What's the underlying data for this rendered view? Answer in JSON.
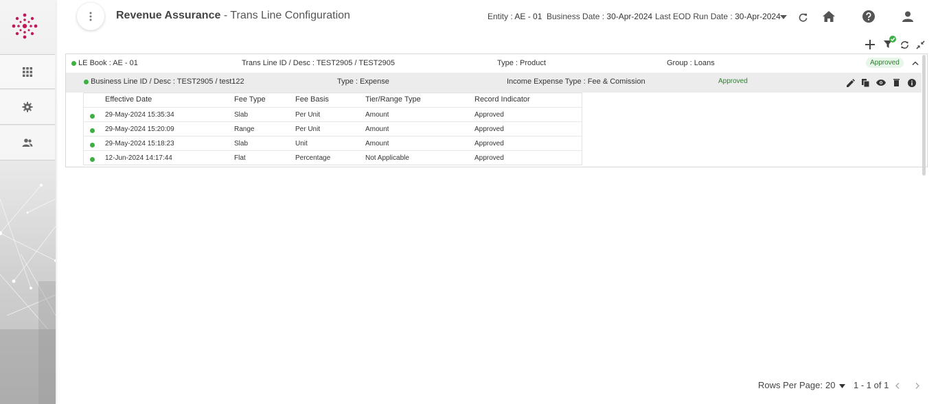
{
  "header": {
    "title_main": "Revenue Assurance",
    "title_sub": " - Trans Line Configuration",
    "entity_label": "Entity :",
    "entity_value": "AE - 01",
    "business_date_label": "Business Date :",
    "business_date_value": "30-Apr-2024",
    "eod_label": "Last EOD Run Date :",
    "eod_value": "30-Apr-2024"
  },
  "record": {
    "le_book": "LE Book : AE - 01",
    "trans_line": "Trans Line ID / Desc : TEST2905 / TEST2905",
    "type": "Type : Product",
    "group": "Group : Loans",
    "status": "Approved"
  },
  "business_line": {
    "id_desc": "Business Line ID / Desc : TEST2905 / test122",
    "type": "Type : Expense",
    "income_expense": "Income Expense Type : Fee & Comission",
    "status": "Approved"
  },
  "table": {
    "headers": [
      "Effective Date",
      "Fee Type",
      "Fee Basis",
      "Tier/Range Type",
      "Record Indicator"
    ],
    "rows": [
      [
        "29-May-2024 15:35:34",
        "Slab",
        "Per Unit",
        "Amount",
        "Approved"
      ],
      [
        "29-May-2024 15:20:09",
        "Range",
        "Per Unit",
        "Amount",
        "Approved"
      ],
      [
        "29-May-2024 15:18:23",
        "Slab",
        "Unit",
        "Amount",
        "Approved"
      ],
      [
        "12-Jun-2024 14:17:44",
        "Flat",
        "Percentage",
        "Not Applicable",
        "Approved"
      ]
    ]
  },
  "footer": {
    "rows_per_page_label": "Rows Per Page:",
    "rows_per_page_value": "20",
    "range": "1 - 1 of 1"
  },
  "icons": {
    "sidebar": [
      "apps-grid-icon",
      "settings-gear-icon",
      "user-management-icon"
    ],
    "toolbar": [
      "add-icon",
      "filter-icon",
      "refresh-icon",
      "collapse-icon"
    ],
    "row_actions": [
      "edit-icon",
      "copy-icon",
      "view-icon",
      "delete-icon",
      "info-icon"
    ]
  },
  "colors": {
    "status_green": "#3cb043",
    "logo_magenta": "#c2185b",
    "approved_text": "#2e7d32"
  }
}
